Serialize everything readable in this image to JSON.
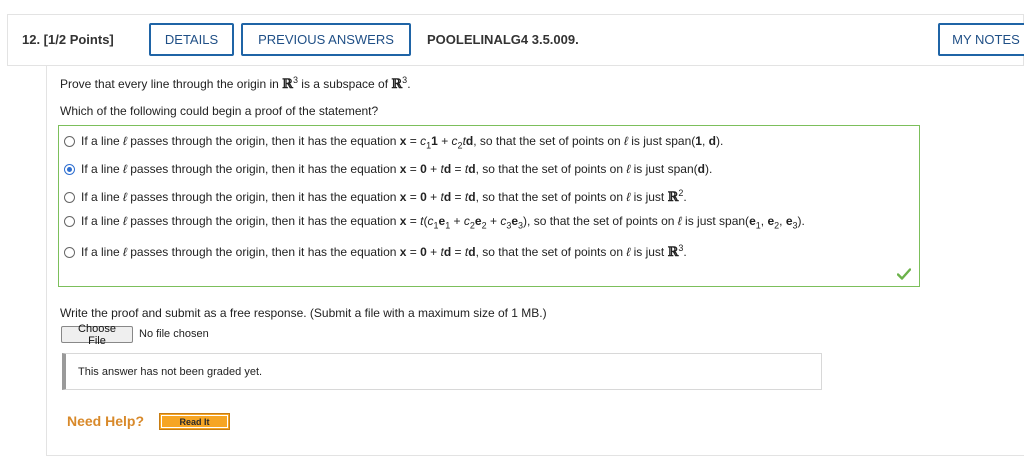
{
  "header": {
    "question_number": "12. [1/2 Points]",
    "details_label": "DETAILS",
    "previous_answers_label": "PREVIOUS ANSWERS",
    "code": "POOLELINALG4 3.5.009.",
    "my_notes_label": "MY NOTES"
  },
  "prompt": {
    "line1_a": "Prove that every line through the origin in ",
    "line1_R": "ℝ",
    "line1_sup": "3",
    "line1_b": " is a subspace of ",
    "line1_R2": "ℝ",
    "line1_sup2": "3",
    "line1_end": ".",
    "line2": "Which of the following could begin a proof of the statement?"
  },
  "choices": [
    {
      "selected": false
    },
    {
      "selected": true
    },
    {
      "selected": false
    },
    {
      "selected": false
    },
    {
      "selected": false
    }
  ],
  "choice_text": {
    "lead": "If a line ",
    "ell": "ℓ",
    "pass": " passes through the origin, then it has the equation ",
    "x": "x",
    "eq": " = ",
    "so": ", so that the set of points on ",
    "isjust": " is just ",
    "c": "c",
    "one_bold": "1",
    "t": "t",
    "d": "d",
    "zero": "0",
    "plus": " + ",
    "span": "span(",
    "close": ").",
    "e": "e",
    "R": "ℝ",
    "sub1": "1",
    "sub2": "2",
    "sub3": "3",
    "sup2": "2",
    "sup3": "3",
    "comma": ", ",
    "dot": "."
  },
  "free_response": {
    "instruction": "Write the proof and submit as a free response. (Submit a file with a maximum size of 1 MB.)",
    "choose_file_label": "Choose File",
    "no_file_text": "No file chosen",
    "graded_text": "This answer has not been graded yet."
  },
  "help": {
    "need_help_label": "Need Help?",
    "read_it_label": "Read It"
  },
  "colors": {
    "accent": "#1f64a6",
    "correct_border": "#7cbf5b",
    "help_orange": "#d8892a",
    "read_it_bg": "#f6a524"
  }
}
